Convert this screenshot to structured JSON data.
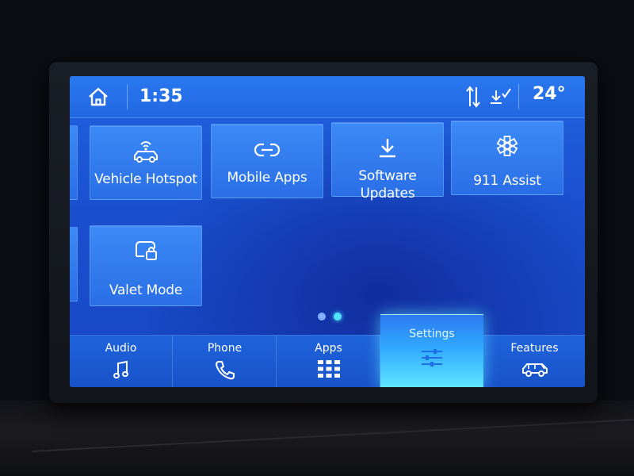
{
  "status_bar": {
    "time": "1:35",
    "temperature": "24°",
    "icons": [
      "home-icon",
      "sort-arrows-icon",
      "download-check-icon"
    ]
  },
  "tiles": [
    {
      "label": "Vehicle Hotspot",
      "icon": "car-wifi-icon"
    },
    {
      "label": "Mobile Apps",
      "icon": "link-icon"
    },
    {
      "label_line1": "Software",
      "label_line2": "Updates",
      "icon": "download-icon"
    },
    {
      "label": "911 Assist",
      "icon": "star-of-life-icon"
    },
    {
      "label": "Valet Mode",
      "icon": "car-lock-icon"
    }
  ],
  "pager": {
    "pages": 2,
    "active": 2
  },
  "nav": [
    {
      "label": "Audio",
      "icon": "music-note-icon"
    },
    {
      "label": "Phone",
      "icon": "phone-icon"
    },
    {
      "label": "Apps",
      "icon": "grid-icon"
    },
    {
      "label": "Settings",
      "icon": "sliders-icon",
      "active": true
    },
    {
      "label": "Features",
      "icon": "car-features-icon"
    }
  ],
  "colors": {
    "screen_blue": "#1f5fdc",
    "tile_blue": "#3381f2",
    "active_glow": "#5fe6ff",
    "text": "#ffffff"
  }
}
